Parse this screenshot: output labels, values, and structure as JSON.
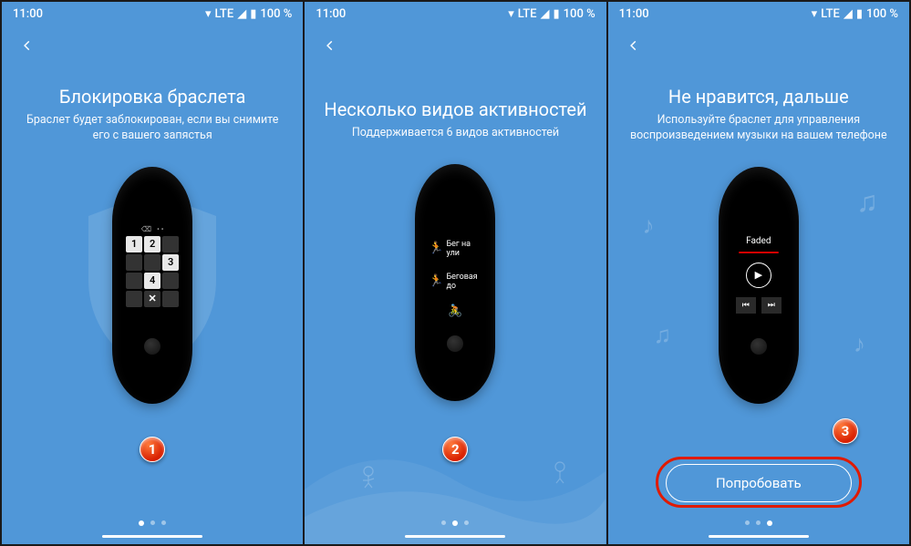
{
  "status": {
    "time": "11:00",
    "net": "LTE",
    "battery": "100 %"
  },
  "screens": [
    {
      "title": "Блокировка браслета",
      "subtitle": "Браслет будет заблокирован, если вы снимите его с вашего запястья",
      "badge": "1",
      "active_dot": 0,
      "band": {
        "keypad": [
          "1",
          "2",
          "",
          "",
          "",
          "3",
          "",
          "4",
          ""
        ],
        "close": "✕"
      }
    },
    {
      "title": "Несколько видов активностей",
      "subtitle": "Поддерживается 6 видов активностей",
      "badge": "2",
      "active_dot": 1,
      "band": {
        "activities": [
          "Бег на ули",
          "Беговая до"
        ]
      }
    },
    {
      "title": "Не нравится, дальше",
      "subtitle": "Используйте браслет для управления воспроизведением музыки на вашем телефоне",
      "badge": "3",
      "active_dot": 2,
      "band": {
        "track": "Faded",
        "play": "▶",
        "prev": "⏮",
        "next": "⏭"
      },
      "cta": "Попробовать"
    }
  ]
}
